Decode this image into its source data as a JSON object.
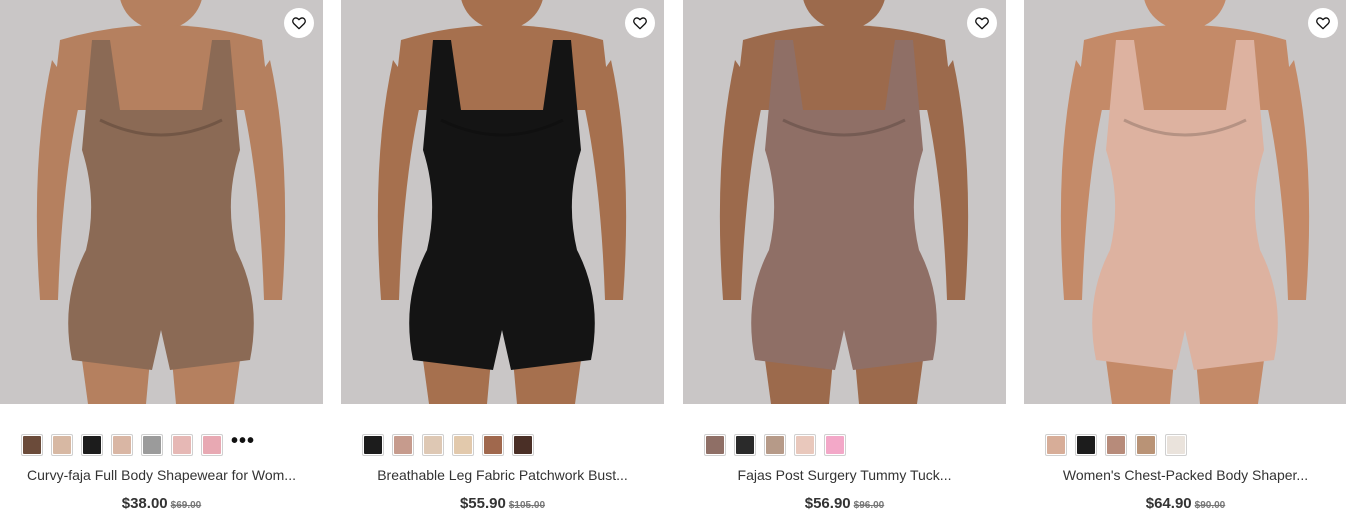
{
  "colors": {
    "background": "#c9c6c6",
    "accent_text": "#333333"
  },
  "products": [
    {
      "title": "Curvy-faja Full Body Shapewear for Wom...",
      "price": "$38.00",
      "original_price": "$69.00",
      "garment_color": "#8b6a55",
      "swatches": [
        "#6b4b3a",
        "#d7b8a3",
        "#1c1c1c",
        "#d9b6a4",
        "#9b9b9b",
        "#e6b8b5",
        "#e8a9b3"
      ],
      "more_label": "•••",
      "wish_icon": "heart-outline-icon"
    },
    {
      "title": "Breathable Leg Fabric Patchwork Bust...",
      "price": "$55.90",
      "original_price": "$105.00",
      "garment_color": "#141414",
      "swatches": [
        "#1c1c1c",
        "#c69b8d",
        "#dec8b4",
        "#e2c9ac",
        "#a0684d",
        "#4a2f26"
      ],
      "wish_icon": "heart-outline-icon"
    },
    {
      "title": "Fajas Post Surgery Tummy Tuck...",
      "price": "$56.90",
      "original_price": "$96.00",
      "garment_color": "#8f6f66",
      "swatches": [
        "#8f6f66",
        "#2a2a2a",
        "#b69a88",
        "#e9c8bc",
        "#f3a8c8"
      ],
      "wish_icon": "heart-outline-icon"
    },
    {
      "title": "Women's Chest-Packed Body Shaper...",
      "price": "$64.90",
      "original_price": "$90.00",
      "garment_color": "#ddb2a0",
      "swatches": [
        "#d7ad98",
        "#1c1c1c",
        "#b78b7a",
        "#b99376",
        "#eae3dc"
      ],
      "wish_icon": "heart-outline-icon"
    }
  ]
}
